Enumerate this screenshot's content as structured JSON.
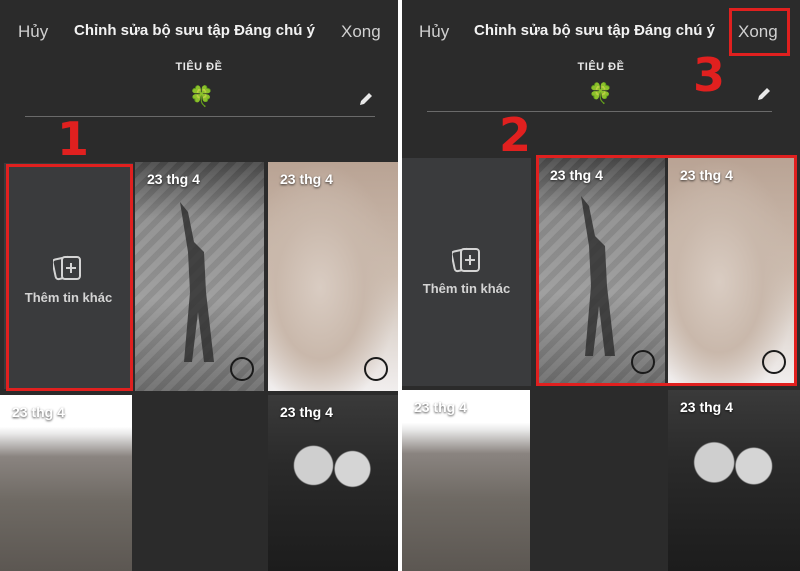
{
  "header": {
    "cancel_label": "Hủy",
    "title": "Chỉnh sửa bộ sưu tập Đáng chú ý",
    "done_label": "Xong"
  },
  "title_section": {
    "label": "TIÊU ĐỀ",
    "cover_emoji": "🍀",
    "edit_icon": "pencil-icon"
  },
  "add_tile": {
    "label": "Thêm tin khác",
    "icon": "add-story-icon"
  },
  "stories": [
    {
      "date": "23 thg 4"
    },
    {
      "date": "23 thg 4"
    },
    {
      "date": "23 thg 4"
    },
    {
      "date": "23 thg 4"
    }
  ],
  "annotations": {
    "step1": "1",
    "step2": "2",
    "step3": "3",
    "highlight_color": "#e0201f"
  },
  "colors": {
    "background": "#2b2b2b",
    "tile": "#3a3b3d",
    "text": "#f2f2f2"
  }
}
